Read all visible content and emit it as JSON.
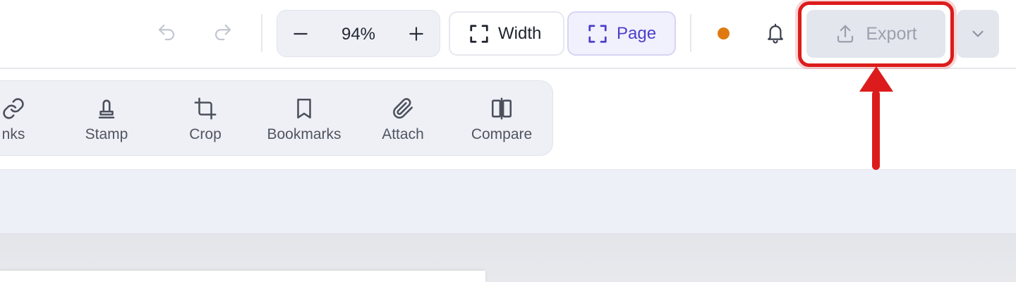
{
  "toolbar": {
    "zoom": {
      "value": "94%"
    },
    "fit_width_label": "Width",
    "fit_page_label": "Page",
    "export_label": "Export",
    "status_color": "#e07a10",
    "accent_color": "#4b3fc9",
    "icons": {
      "undo": "undo-icon",
      "redo": "redo-icon",
      "zoom_out": "minus-icon",
      "zoom_in": "plus-icon",
      "fit": "fit-frame-icon",
      "notifications": "bell-icon",
      "export": "upload-icon",
      "menu": "chevron-down-icon"
    }
  },
  "tools": [
    {
      "label": "nks",
      "icon": "link-icon"
    },
    {
      "label": "Stamp",
      "icon": "stamp-icon"
    },
    {
      "label": "Crop",
      "icon": "crop-icon"
    },
    {
      "label": "Bookmarks",
      "icon": "bookmark-icon"
    },
    {
      "label": "Attach",
      "icon": "paperclip-icon"
    },
    {
      "label": "Compare",
      "icon": "compare-icon"
    }
  ],
  "annotation": {
    "color": "#dc1c1c",
    "target": "export-button"
  }
}
